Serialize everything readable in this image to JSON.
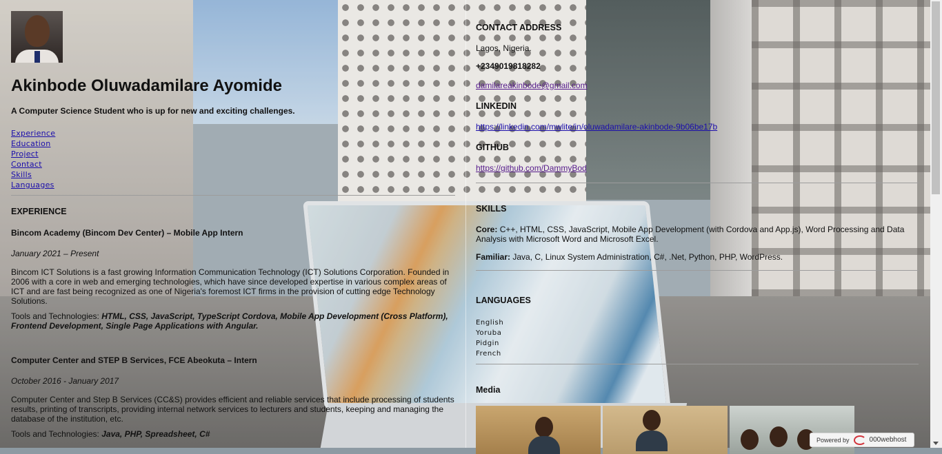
{
  "profile": {
    "name": "Akinbode Oluwadamilare Ayomide",
    "tagline": "A Computer Science Student who is up for new and exciting challenges."
  },
  "nav": [
    "Experience",
    "Education",
    "Project",
    "Contact",
    "Skills",
    "Languages"
  ],
  "experience": {
    "heading": "EXPERIENCE",
    "jobs": [
      {
        "title": "Bincom Academy (Bincom Dev Center) – Mobile App Intern",
        "date": "January 2021 – Present",
        "description": "Bincom ICT Solutions is a fast growing Information Communication Technology (ICT) Solutions Corporation. Founded in 2006 with a core in web and emerging technologies, which have since developed expertise in various complex areas of ICT and are fast being recognized as one of Nigeria's foremost ICT firms in the provision of cutting edge Technology Solutions.",
        "tools_label": "Tools and Technologies:",
        "tools": "HTML, CSS, JavaScript, TypeScript Cordova, Mobile App Development (Cross Platform), Frontend Development, Single Page Applications with Angular."
      },
      {
        "title": "Computer Center and STEP B Services, FCE Abeokuta – Intern",
        "date": "October 2016 - January 2017",
        "description": "Computer Center and Step B Services (CC&S) provides efficient and reliable services that include processing of students results, printing of transcripts, providing internal network services to lecturers and students, keeping and managing the database of the institution, etc.",
        "tools_label": "Tools and Technologies:",
        "tools": "Java, PHP, Spreadsheet, C#"
      }
    ]
  },
  "contact": {
    "heading": "CONTACT ADDRESS",
    "address": "Lagos, Nigeria.",
    "phone": "+2349019818282",
    "email": "damilareakinbode@gmail.com"
  },
  "linkedin": {
    "heading": "LINKEDIN",
    "url": "https://linkedin.com/mwlite/in/oluwadamilare-akinbode-9b06be17b"
  },
  "github": {
    "heading": "GITHUB",
    "url": "https://github.com/DammyBod"
  },
  "skills": {
    "heading": "SKILLS",
    "core_label": "Core:",
    "core": "C++, HTML, CSS, JavaScript, Mobile App Development (with Cordova and App.js), Word Processing and Data Analysis with Microsoft Word and Microsoft Excel.",
    "familiar_label": "Familiar:",
    "familiar": "Java, C, Linux System Administration, C#, .Net, Python, PHP, WordPress."
  },
  "languages": {
    "heading": "LANGUAGES",
    "items": [
      "English",
      "Yoruba",
      "Pidgin",
      "French"
    ]
  },
  "media": {
    "heading": "Media"
  },
  "badge": {
    "powered": "Powered by",
    "brand": "000webhost",
    "color": "#d2343c"
  }
}
